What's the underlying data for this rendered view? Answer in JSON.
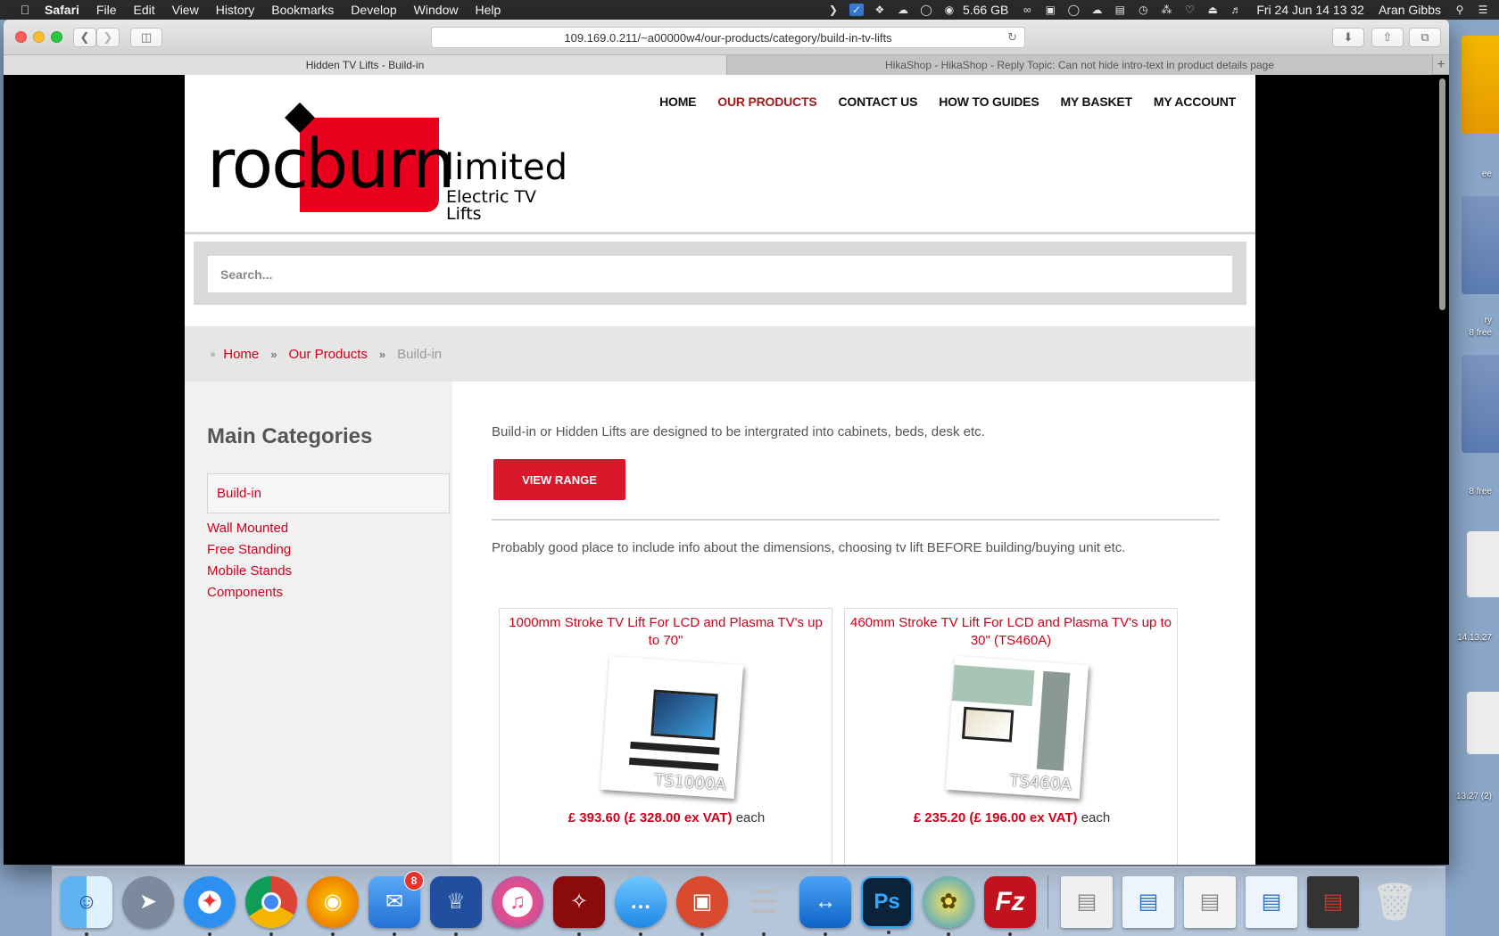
{
  "menubar": {
    "app": "Safari",
    "items": [
      "File",
      "Edit",
      "View",
      "History",
      "Bookmarks",
      "Develop",
      "Window",
      "Help"
    ],
    "disk": "5.66 GB",
    "datetime": "Fri 24 Jun  14 13 32",
    "user": "Aran Gibbs"
  },
  "browser": {
    "url": "109.169.0.211/~a00000w4/our-products/category/build-in-tv-lifts",
    "tabs": [
      {
        "title": "Hidden TV Lifts - Build-in",
        "active": true
      },
      {
        "title": "HikaShop - HikaShop - Reply Topic: Can not hide intro-text in product details page",
        "active": false
      }
    ]
  },
  "site": {
    "logo": {
      "part1": "roc",
      "part2": "burn",
      "word": "limited",
      "tagline": "Electric TV Lifts"
    },
    "nav": [
      {
        "label": "HOME",
        "active": false
      },
      {
        "label": "OUR PRODUCTS",
        "active": true
      },
      {
        "label": "CONTACT US",
        "active": false
      },
      {
        "label": "HOW TO GUIDES",
        "active": false
      },
      {
        "label": "MY BASKET",
        "active": false
      },
      {
        "label": "MY ACCOUNT",
        "active": false
      }
    ],
    "search": {
      "placeholder": "Search..."
    },
    "breadcrumb": {
      "home": "Home",
      "products": "Our Products",
      "current": "Build-in"
    },
    "sidebar": {
      "title": "Main Categories",
      "active": "Build-in",
      "items": [
        "Wall Mounted",
        "Free Standing",
        "Mobile Stands",
        "Components"
      ]
    },
    "main": {
      "intro": "Build-in or Hidden Lifts are  designed to be intergrated into cabinets, beds, desk etc.",
      "button": "VIEW RANGE",
      "info": "Probably good place to include info about the dimensions, choosing tv lift BEFORE building/buying unit etc.",
      "products": [
        {
          "title": "1000mm Stroke TV Lift For LCD and Plasma TV's up to 70\"",
          "image_label": "TS1000A",
          "price": "£ 393.60 (£ 328.00 ex VAT)",
          "suffix": "each"
        },
        {
          "title": "460mm Stroke TV Lift For LCD and Plasma TV's up to 30\" (TS460A)",
          "image_label": "TS460A",
          "price": "£ 235.20 (£ 196.00 ex VAT)",
          "suffix": "each"
        }
      ]
    }
  },
  "desktop": {
    "labels": [
      "ee",
      "ry",
      "8 free",
      "8 free",
      "14.13.27",
      "13.27 (2)"
    ]
  },
  "dock": {
    "mail_badge": "8",
    "apps": [
      "Finder",
      "Launchpad",
      "Safari",
      "Chrome",
      "Firefox",
      "Mail",
      "Crown",
      "iTunes",
      "Acrobat",
      "Messages",
      "Presentation",
      "Script",
      "TeamViewer",
      "Photoshop",
      "Coda",
      "FileZilla"
    ]
  }
}
